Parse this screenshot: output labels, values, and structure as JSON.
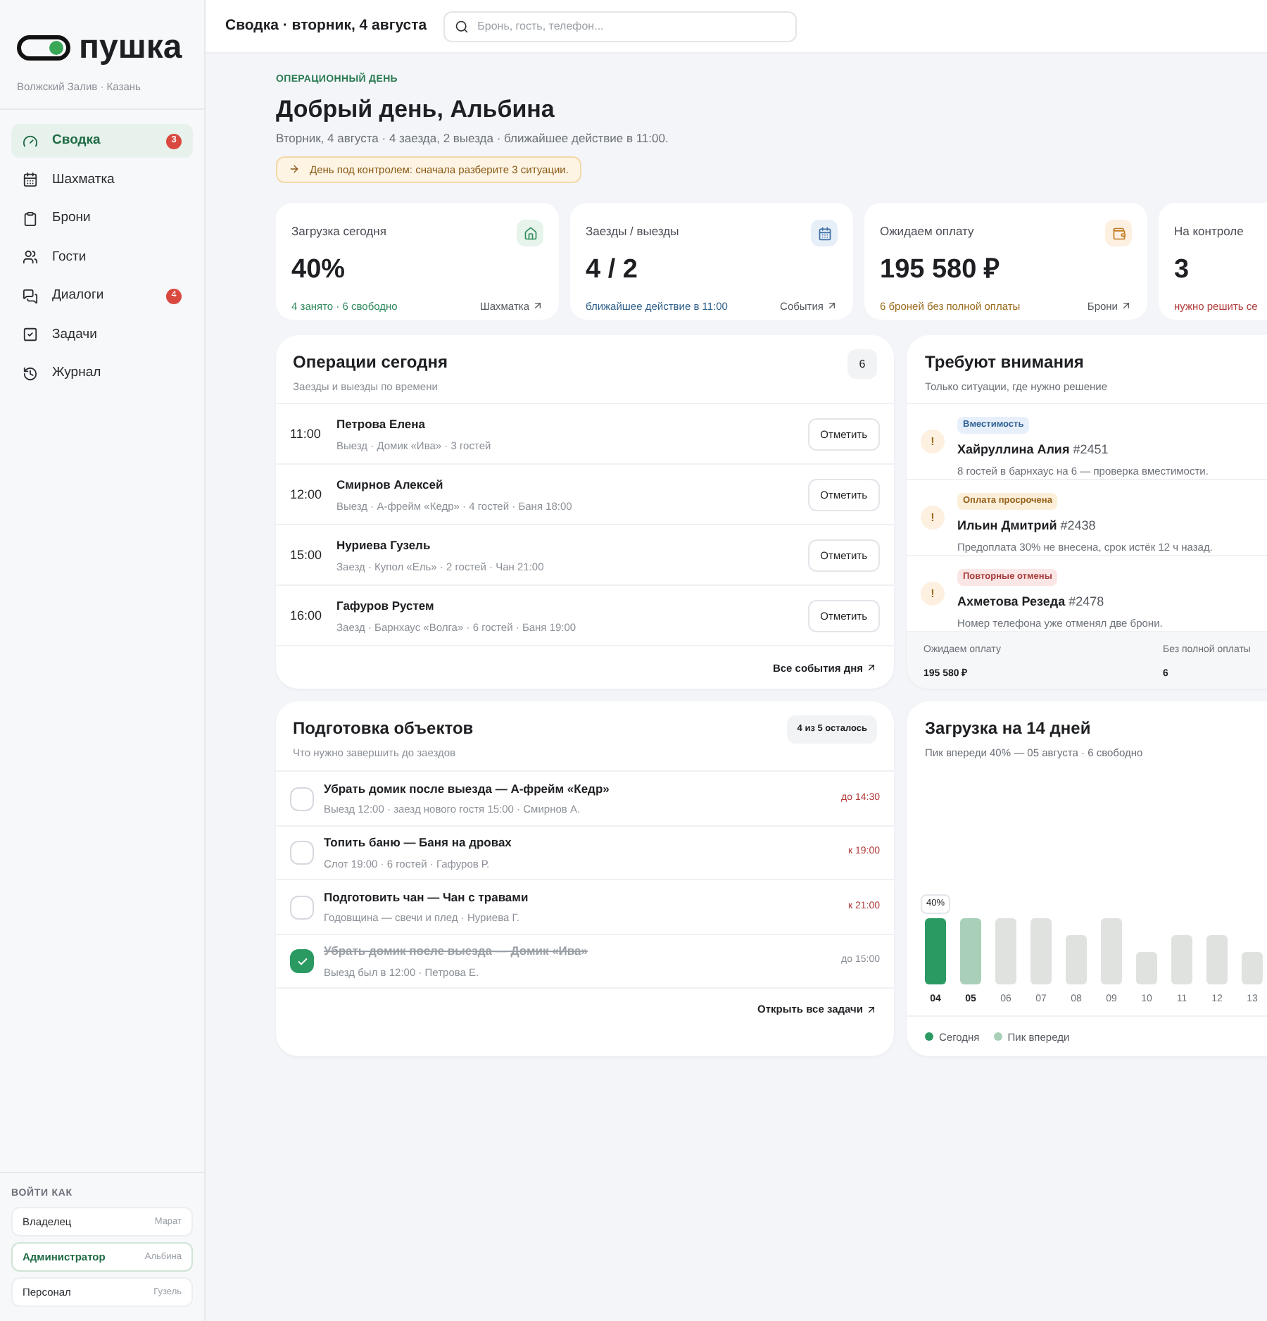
{
  "brand": {
    "name": "пушка",
    "location": "Волжский Залив · Казань"
  },
  "nav": [
    {
      "label": "Сводка",
      "selected": true,
      "badge": "3"
    },
    {
      "label": "Шахматка",
      "selected": false
    },
    {
      "label": "Брони",
      "selected": false
    },
    {
      "label": "Гости",
      "selected": false
    },
    {
      "label": "Диалоги",
      "selected": false,
      "badge": "4"
    },
    {
      "label": "Задачи",
      "selected": false
    },
    {
      "label": "Журнал",
      "selected": false
    }
  ],
  "login_as": {
    "title": "ВОЙТИ КАК",
    "roles": [
      {
        "role": "Владелец",
        "name": "Марат",
        "selected": false
      },
      {
        "role": "Администратор",
        "name": "Альбина",
        "selected": true
      },
      {
        "role": "Персонал",
        "name": "Гузель",
        "selected": false
      }
    ]
  },
  "header": {
    "title": "Сводка · вторник, 4 августа",
    "search": {
      "placeholder": "Бронь, гость, телефон..."
    }
  },
  "greeting": {
    "kicker": "ОПЕРАЦИОННЫЙ ДЕНЬ",
    "title": "Добрый день, Альбина",
    "subtitle": "Вторник, 4 августа · 4 заезда, 2 выезда · ближайшее действие в 11:00.",
    "alert": "День под контролем: сначала разберите 3 ситуации."
  },
  "stats": [
    {
      "kind": "load",
      "label": "Загрузка сегодня",
      "value": "40%",
      "note": "4 занято · 6 свободно",
      "link": "Шахматка"
    },
    {
      "kind": "arrivals",
      "label": "Заезды / выезды",
      "value": "4 / 2",
      "note": "ближайшее действие в 11:00",
      "link": "События"
    },
    {
      "kind": "payment",
      "label": "Ожидаем оплату",
      "value": "195 580 ₽",
      "note": "6 броней без полной оплаты",
      "link": "Брони"
    },
    {
      "kind": "control",
      "label": "На контроле",
      "value": "3",
      "note": "нужно решить се"
    }
  ],
  "operations": {
    "title": "Операции сегодня",
    "subtitle": "Заезды и выезды по времени",
    "count": "6",
    "footer_link": "Все события дня",
    "rows": [
      {
        "time": "11:00",
        "name": "Петрова Елена",
        "details": "Выезд · Домик «Ива» · 3 гостей",
        "action": "Отметить"
      },
      {
        "time": "12:00",
        "name": "Смирнов Алексей",
        "details": "Выезд · А-фрейм «Кедр» · 4 гостей · Баня 18:00",
        "action": "Отметить"
      },
      {
        "time": "15:00",
        "name": "Нуриева Гузель",
        "details": "Заезд · Купол «Ель» · 2 гостей · Чан 21:00",
        "action": "Отметить"
      },
      {
        "time": "16:00",
        "name": "Гафуров Рустем",
        "details": "Заезд · Барнхаус «Волга» · 6 гостей · Баня 19:00",
        "action": "Отметить"
      }
    ]
  },
  "attention": {
    "title": "Требуют внимания",
    "subtitle": "Только ситуации, где нужно решение",
    "items": [
      {
        "kind": "capacity",
        "mark": "!",
        "tag": "Вместимость",
        "name": "Хайруллина Алия",
        "number": "#2451",
        "text": "8 гостей в барнхаус на 6 — проверка вместимости."
      },
      {
        "kind": "overdue",
        "mark": "!",
        "tag": "Оплата просрочена",
        "name": "Ильин Дмитрий",
        "number": "#2438",
        "text": "Предоплата 30% не внесена, срок истёк 12 ч назад."
      },
      {
        "kind": "cancel",
        "mark": "!",
        "tag": "Повторные отмены",
        "name": "Ахметова Резеда",
        "number": "#2478",
        "text": "Номер телефона уже отменял две брони."
      }
    ],
    "summary": [
      {
        "label": "Ожидаем оплату",
        "value": "195 580 ₽"
      },
      {
        "label": "Без полной оплаты",
        "value": "6"
      }
    ]
  },
  "tasks": {
    "title": "Подготовка объектов",
    "subtitle": "Что нужно завершить до заездов",
    "badge": "4 из 5 осталось",
    "footer_link": "Открыть все задачи",
    "items": [
      {
        "title": "Убрать домик после выезда — А-фрейм «Кедр»",
        "details": "Выезд 12:00 · заезд нового гостя 15:00 · Смирнов А.",
        "deadline": "до 14:30",
        "checked": false
      },
      {
        "title": "Топить баню — Баня на дровах",
        "details": "Слот 19:00 · 6 гостей · Гафуров Р.",
        "deadline": "к 19:00",
        "checked": false
      },
      {
        "title": "Подготовить чан — Чан с травами",
        "details": "Годовщина — свечи и плед · Нуриева Г.",
        "deadline": "к 21:00",
        "checked": false
      },
      {
        "title": "Убрать домик после выезда — Домик «Ива»",
        "details": "Выезд был в 12:00 · Петрова Е.",
        "deadline": "до 15:00",
        "checked": true
      }
    ]
  },
  "forecast": {
    "title": "Загрузка на 14 дней",
    "subtitle": "Пик впереди 40% — 05 августа · 6 свободно",
    "value_label": "40%",
    "days": [
      {
        "label": "04",
        "kind": "today"
      },
      {
        "label": "05",
        "kind": "peak"
      },
      {
        "label": "06",
        "kind": "normal"
      },
      {
        "label": "07",
        "kind": "normal"
      },
      {
        "label": "08",
        "kind": "normal"
      },
      {
        "label": "09",
        "kind": "normal"
      },
      {
        "label": "10",
        "kind": "normal"
      },
      {
        "label": "11",
        "kind": "normal"
      },
      {
        "label": "12",
        "kind": "normal"
      },
      {
        "label": "13",
        "kind": "normal"
      }
    ],
    "legend": [
      {
        "kind": "today",
        "label": "Сегодня"
      },
      {
        "kind": "peak",
        "label": "Пик впереди"
      }
    ]
  }
}
